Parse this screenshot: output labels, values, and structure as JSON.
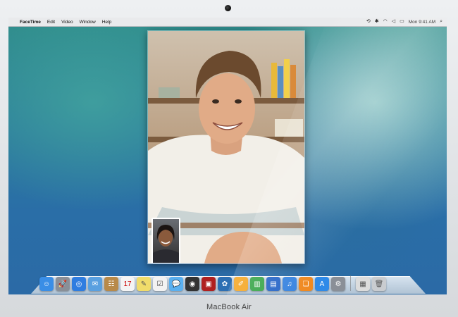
{
  "menubar": {
    "apple_glyph": "",
    "items": [
      {
        "label": "FaceTime",
        "bold": true
      },
      {
        "label": "Edit"
      },
      {
        "label": "Video"
      },
      {
        "label": "Window"
      },
      {
        "label": "Help"
      }
    ],
    "clock": "Mon 9:41 AM",
    "status_icons": [
      "time-machine-icon",
      "bluetooth-icon",
      "wifi-icon",
      "volume-icon",
      "battery-icon"
    ],
    "search_icon": "spotlight-search-icon"
  },
  "facetime": {
    "remote_caller_icon": "remote-video-feed",
    "self_view_icon": "self-view-pip"
  },
  "dock": {
    "items": [
      {
        "name": "finder-icon",
        "glyph": "☺",
        "color": "#3a8ee6"
      },
      {
        "name": "launchpad-icon",
        "glyph": "🚀",
        "color": "#8a8f97"
      },
      {
        "name": "safari-icon",
        "glyph": "◎",
        "color": "#2f7de0"
      },
      {
        "name": "mail-icon",
        "glyph": "✉",
        "color": "#5aa0e0"
      },
      {
        "name": "contacts-icon",
        "glyph": "☷",
        "color": "#b88a4a"
      },
      {
        "name": "calendar-icon",
        "glyph": "17",
        "color": "#f4f4f4",
        "text": "#c00"
      },
      {
        "name": "notes-icon",
        "glyph": "✎",
        "color": "#f0dc6a",
        "text": "#555"
      },
      {
        "name": "reminders-icon",
        "glyph": "☑",
        "color": "#f2f2f2",
        "text": "#444"
      },
      {
        "name": "messages-icon",
        "glyph": "💬",
        "color": "#5ab0f0"
      },
      {
        "name": "facetime-icon",
        "glyph": "◉",
        "color": "#333"
      },
      {
        "name": "photo-booth-icon",
        "glyph": "▣",
        "color": "#b02020"
      },
      {
        "name": "iphoto-icon",
        "glyph": "✿",
        "color": "#2d6fb3"
      },
      {
        "name": "pages-icon",
        "glyph": "✐",
        "color": "#f5a623"
      },
      {
        "name": "numbers-icon",
        "glyph": "▥",
        "color": "#3aa64a"
      },
      {
        "name": "keynote-icon",
        "glyph": "▤",
        "color": "#2a68c8"
      },
      {
        "name": "itunes-icon",
        "glyph": "♫",
        "color": "#3a85e0"
      },
      {
        "name": "ibooks-icon",
        "glyph": "❏",
        "color": "#f08a22"
      },
      {
        "name": "app-store-icon",
        "glyph": "A",
        "color": "#2f8ae8"
      },
      {
        "name": "system-preferences-icon",
        "glyph": "⚙",
        "color": "#8a8f97"
      }
    ],
    "trailing": [
      {
        "name": "documents-stack-icon",
        "glyph": "▦",
        "color": "#dcdcdc",
        "text": "#555"
      },
      {
        "name": "trash-icon",
        "glyph": "🗑",
        "color": "#c9ccd0",
        "text": "#555"
      }
    ]
  },
  "device": {
    "label": "MacBook Air"
  }
}
